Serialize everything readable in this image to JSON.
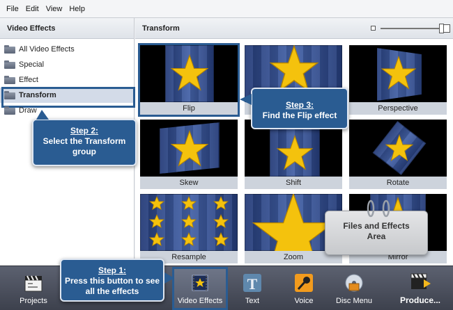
{
  "menu": [
    "File",
    "Edit",
    "View",
    "Help"
  ],
  "left_panel": {
    "title": "Video Effects",
    "items": [
      {
        "label": "All Video Effects"
      },
      {
        "label": "Special"
      },
      {
        "label": "Effect"
      },
      {
        "label": "Transform",
        "selected": true
      },
      {
        "label": "Draw"
      }
    ]
  },
  "right_panel": {
    "title": "Transform",
    "effects": [
      "Flip",
      "",
      "Perspective",
      "Skew",
      "Shift",
      "Rotate",
      "Resample",
      "Zoom",
      "Mirror"
    ]
  },
  "toolbar": {
    "projects": "Projects",
    "video_effects": "Video Effects",
    "text": "Text",
    "voice": "Voice",
    "disc_menu": "Disc Menu",
    "produce": "Produce..."
  },
  "callouts": {
    "step1": {
      "title": "Step 1:",
      "text": "Press this button to see all the effects"
    },
    "step2": {
      "title": "Step 2:",
      "text": "Select the Transform group"
    },
    "step3": {
      "title": "Step 3:",
      "text": "Find the Flip effect"
    },
    "area": {
      "text": "Files and Effects Area"
    }
  },
  "colors": {
    "accent": "#2a5c92",
    "star": "#f4c20d"
  }
}
